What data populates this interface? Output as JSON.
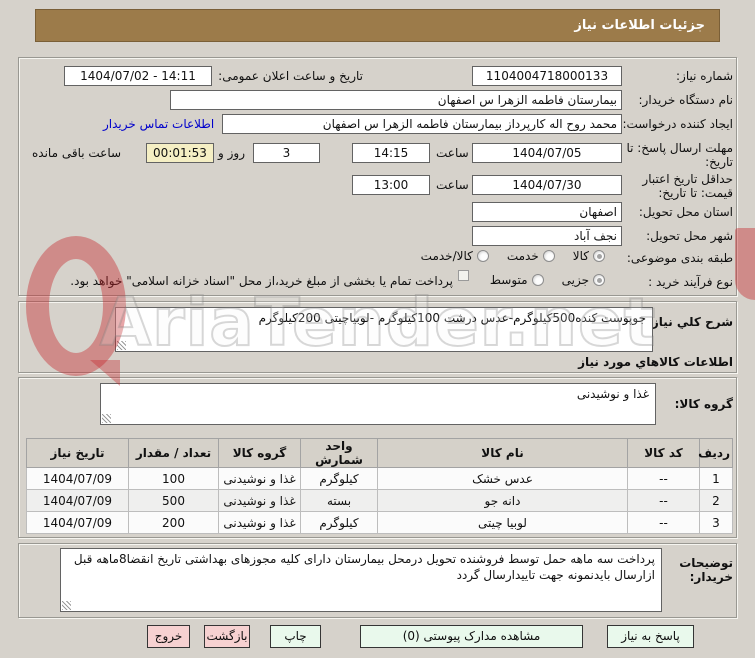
{
  "watermark": "AriaTender.net",
  "title_bar": {
    "text": "جزئیات اطلاعات نیاز"
  },
  "form": {
    "need_number": {
      "label": "شماره نیاز:",
      "value": "1104004718000133"
    },
    "announce": {
      "label": "تاریخ و ساعت اعلان عمومی:",
      "value": "1404/07/02 - 14:11"
    },
    "buyer_org": {
      "label": "نام دستگاه خریدار:",
      "value": "بیمارستان فاطمه الزهرا س  اصفهان"
    },
    "requester": {
      "label": "ایجاد کننده درخواست:",
      "value": "محمد روح اله کارپرداز بیمارستان فاطمه الزهرا س  اصفهان"
    },
    "contact_link": "اطلاعات تماس خریدار",
    "deadline": {
      "label": "مهلت ارسال پاسخ: تا تاریخ:",
      "date": "1404/07/05",
      "hour_label": "ساعت",
      "time": "14:15"
    },
    "remaining": {
      "days": "3",
      "days_label": "روز و",
      "time": "00:01:53",
      "suffix_label": "ساعت باقی مانده"
    },
    "validity": {
      "label": "حداقل تاریخ اعتبار قیمت: تا تاریخ:",
      "date": "1404/07/30",
      "hour_label": "ساعت",
      "time": "13:00"
    },
    "province": {
      "label": "استان محل تحویل:",
      "value": "اصفهان"
    },
    "city": {
      "label": "شهر محل تحویل:",
      "value": "نجف آباد"
    },
    "classification": {
      "label": "طبقه بندی موضوعی:",
      "options": [
        {
          "label": "کالا",
          "selected": true
        },
        {
          "label": "خدمت",
          "selected": false
        },
        {
          "label": "کالا/خدمت",
          "selected": false
        }
      ]
    },
    "process": {
      "label": "نوع فرآیند خرید :",
      "options": [
        {
          "label": "جزیی",
          "selected": true
        },
        {
          "label": "متوسط",
          "selected": false
        }
      ],
      "treasury_checkbox": "پرداخت تمام یا بخشی از مبلغ خرید،از محل \"اسناد خزانه اسلامی\" خواهد بود."
    }
  },
  "description": {
    "label": "شرح کلي نیاز:",
    "value": "جوپوست کنده500کیلوگرم-عدس درشت 100کیلوگرم -لوبیاچیتی 200کیلوگرم"
  },
  "goods": {
    "section_header": "اطلاعات کالاهاي مورد نیاز",
    "group_label": "گروه کالا:",
    "group_value": "غذا و نوشیدنی",
    "table": {
      "headers": [
        "ردیف",
        "کد کالا",
        "نام کالا",
        "واحد شمارش",
        "گروه کالا",
        "تعداد / مقدار",
        "تاریخ نیاز"
      ],
      "rows": [
        [
          "1",
          "--",
          "عدس خشک",
          "کیلوگرم",
          "غذا و نوشیدنی",
          "100",
          "1404/07/09"
        ],
        [
          "2",
          "--",
          "دانه جو",
          "بسته",
          "غذا و نوشیدنی",
          "500",
          "1404/07/09"
        ],
        [
          "3",
          "--",
          "لوبیا چیتی",
          "کیلوگرم",
          "غذا و نوشیدنی",
          "200",
          "1404/07/09"
        ]
      ]
    }
  },
  "notes": {
    "label": "توضیحات خریدار:",
    "value": "پرداخت سه ماهه حمل توسط فروشنده تحویل درمحل بیمارستان دارای کلیه مجوزهای بهداشتی  تاریخ انقضا8ماهه قبل ازارسال بایدنمونه جهت تاییدارسال گردد"
  },
  "buttons": {
    "respond": "پاسخ به نیاز",
    "view_docs": "مشاهده مدارک پیوستی (0)",
    "print": "چاپ",
    "back": "بازگشت",
    "exit": "خروج"
  },
  "colors": {
    "title_bar_bg": "#9c7b4a",
    "remaining_bg": "#f5efc4",
    "link": "#0000cc",
    "button_green_bg": "#e9f9ec",
    "button_pink_bg": "#f6d1d1"
  }
}
